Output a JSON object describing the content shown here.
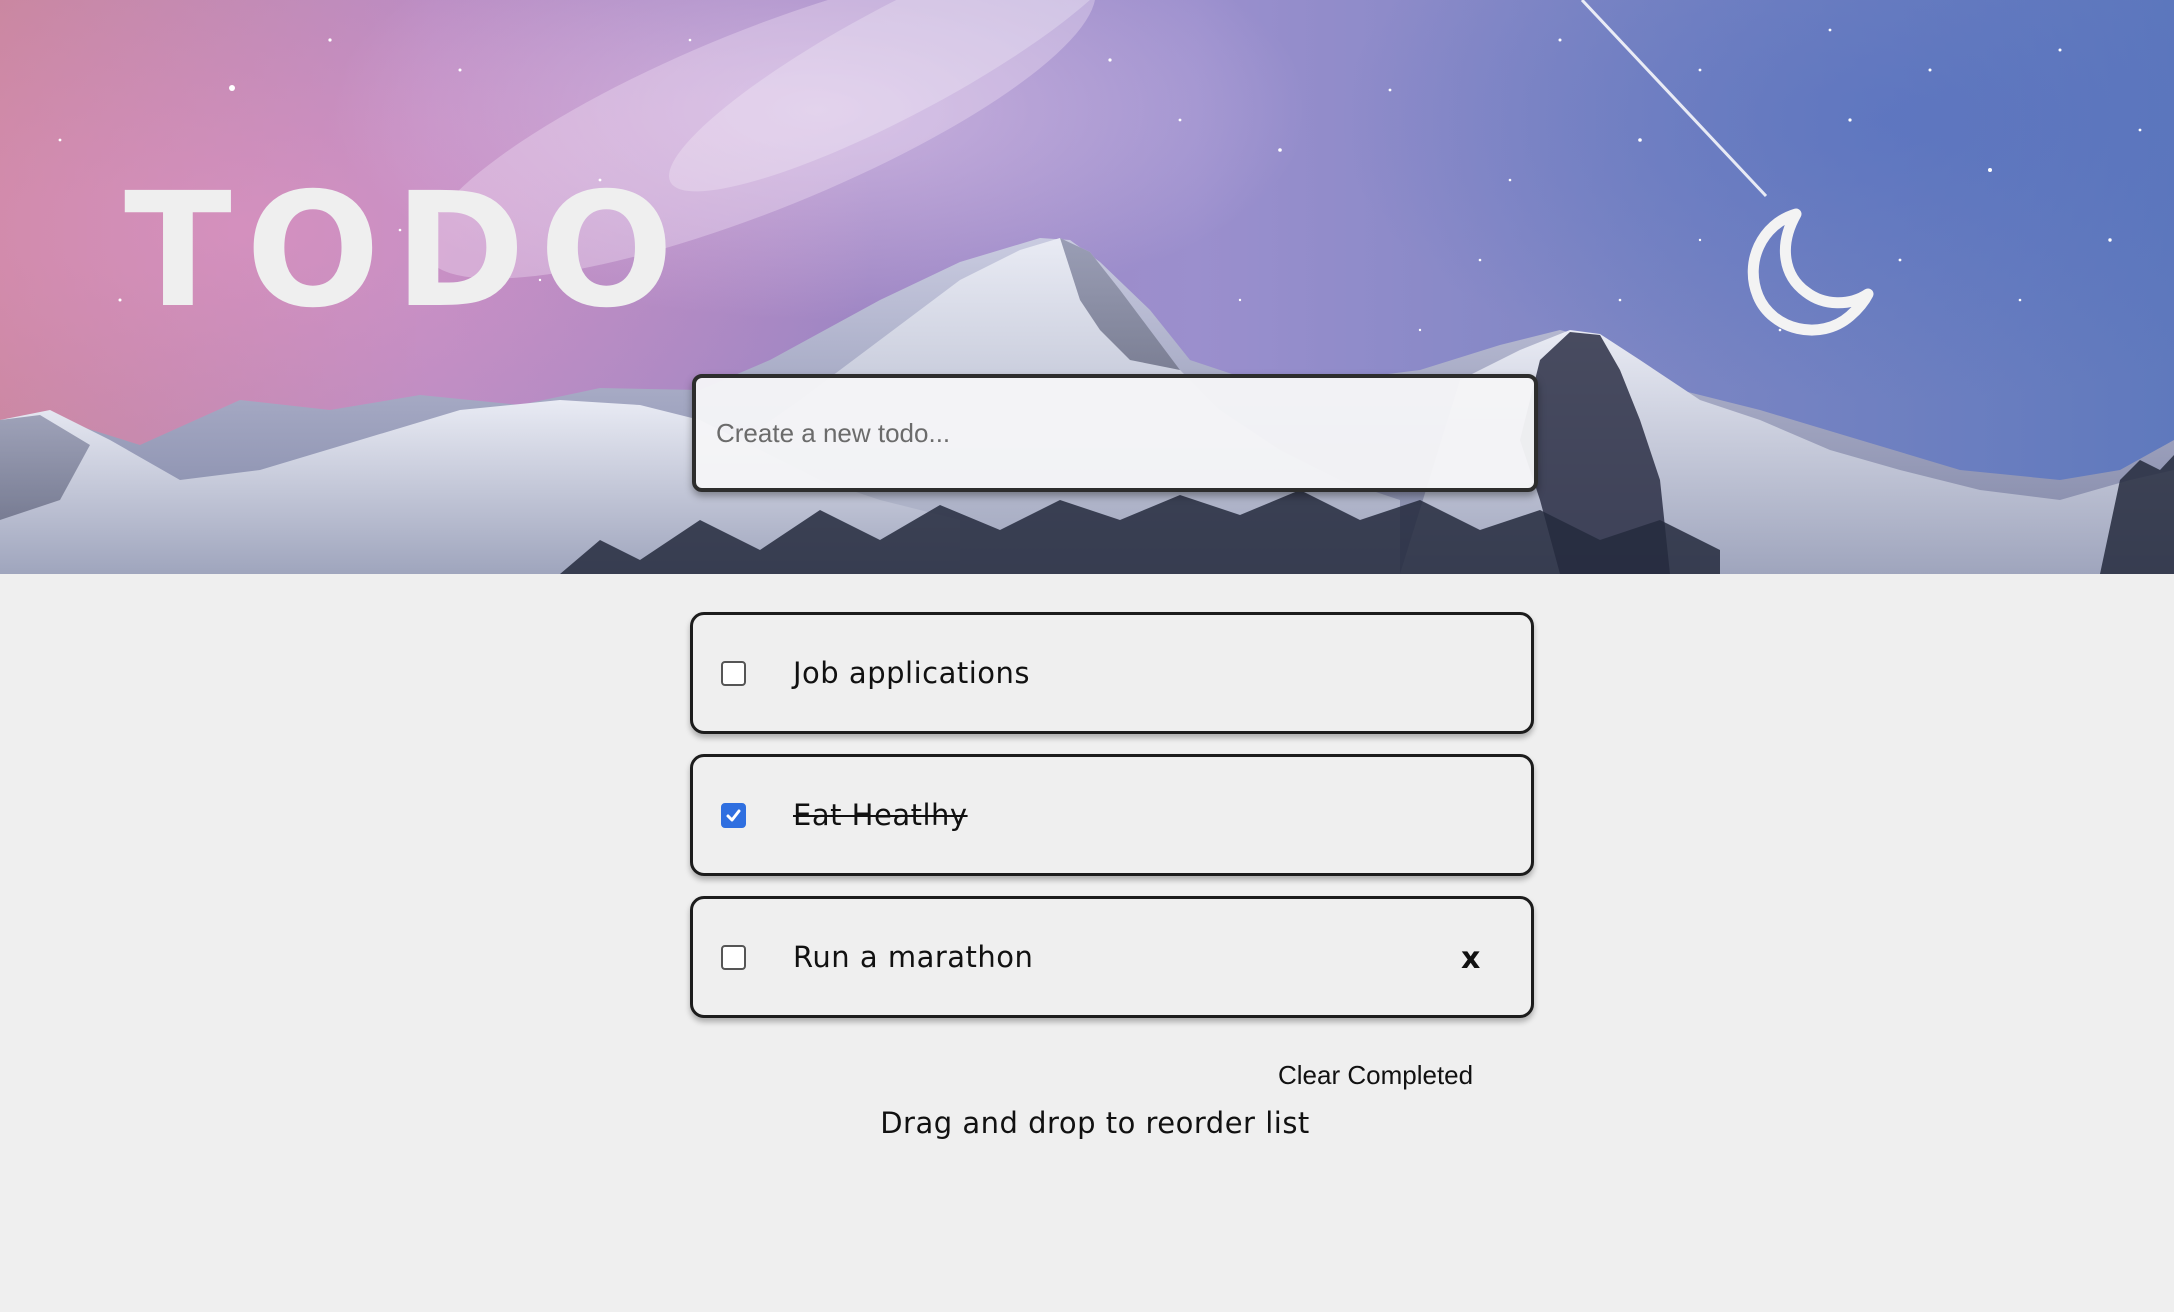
{
  "header": {
    "title": "TODO",
    "theme_toggle_icon": "moon-icon"
  },
  "new_todo": {
    "placeholder": "Create a new todo...",
    "value": ""
  },
  "todos": [
    {
      "text": "Job applications",
      "completed": false
    },
    {
      "text": "Eat Heatlhy",
      "completed": true
    },
    {
      "text": "Run a marathon",
      "completed": false,
      "delete_label": "x"
    }
  ],
  "footer": {
    "clear_completed_label": "Clear Completed",
    "hint": "Drag and drop to reorder list"
  },
  "colors": {
    "background": "#efefef",
    "checkbox_checked": "#2f6fe0",
    "text": "#111111"
  }
}
